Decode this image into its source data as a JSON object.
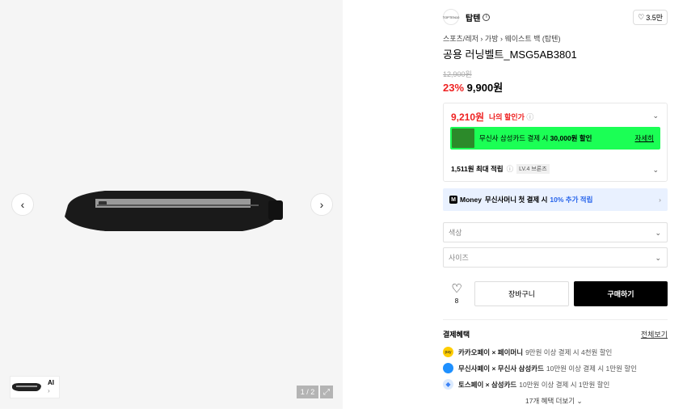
{
  "gallery": {
    "prev_icon": "chevron-left-icon",
    "next_icon": "chevron-right-icon",
    "thumb_label": "AI",
    "counter": "1 / 2"
  },
  "brand": {
    "logo_text": "TOPTEN10",
    "name": "탑텐",
    "likes": "3.5만"
  },
  "breadcrumb": [
    "스포츠/레저",
    "가방",
    "웨이스트 백 (탑텐)"
  ],
  "product": {
    "title": "공용 러닝벨트_MSG5AB3801",
    "original_price": "12,900원",
    "discount": "23%",
    "price": "9,900원"
  },
  "benefits": {
    "my_price": "9,210원",
    "my_price_label": "나의 할인가",
    "promo_text": "무신사 삼성카드 결제 시",
    "promo_amount": "30,000원 할인",
    "promo_link": "자세히",
    "points": "1,511원 최대 적립",
    "level": "LV.4 브론즈"
  },
  "money_banner": {
    "logo": "M",
    "brand": "Money",
    "text": "무신사머니 첫 결제 시",
    "highlight": "10% 추가 적립"
  },
  "options": {
    "color_placeholder": "색상",
    "size_placeholder": "사이즈"
  },
  "actions": {
    "wish_count": "8",
    "cart": "장바구니",
    "buy": "구매하기"
  },
  "payment": {
    "title": "결제혜택",
    "view_all": "전체보기",
    "rows": [
      {
        "name": "카카오페이 × 페이머니",
        "detail": "9만원 이상 결제 시 4천원 할인",
        "color": "#ffcd00"
      },
      {
        "name": "무신사페이 × 무신사 삼성카드",
        "detail": "10만원 이상 결제 시 1만원 할인",
        "color": "#1e90ff"
      },
      {
        "name": "토스페이 × 삼성카드",
        "detail": "10만원 이상 결제 시 1만원 할인",
        "color": "#3b82f6"
      }
    ],
    "more": "17개 혜택 더보기"
  }
}
